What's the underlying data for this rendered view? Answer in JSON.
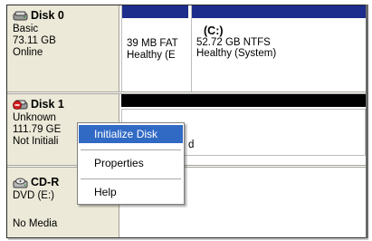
{
  "disks": [
    {
      "name": "Disk 0",
      "type": "Basic",
      "size": "73.11 GB",
      "status": "Online",
      "icon": "hdd-icon",
      "partitions": [
        {
          "line1": "",
          "line2": "39 MB FAT",
          "line3": "Healthy (E"
        },
        {
          "line1": "(C:)",
          "line2": "52.72 GB NTFS",
          "line3": "Healthy (System)"
        }
      ]
    },
    {
      "name": "Disk 1",
      "type": "Unknown",
      "size": "111.79 GE",
      "status": "Not Initiali",
      "icon": "hdd-uninitialized-icon",
      "partitions": [
        {
          "line1": "",
          "line2": "",
          "line3": "d"
        }
      ]
    },
    {
      "name": "CD-R",
      "type": "DVD (E:)",
      "size": "",
      "status": "No Media",
      "icon": "cdrom-icon",
      "partitions": []
    }
  ],
  "context_menu": {
    "items": [
      "Initialize Disk",
      "Properties",
      "Help"
    ],
    "highlighted_index": 0
  },
  "colors": {
    "partition_bar": "#1d2d8c",
    "unallocated_bar": "#000000",
    "menu_highlight": "#316ac5",
    "label_background": "#ece9d8"
  }
}
